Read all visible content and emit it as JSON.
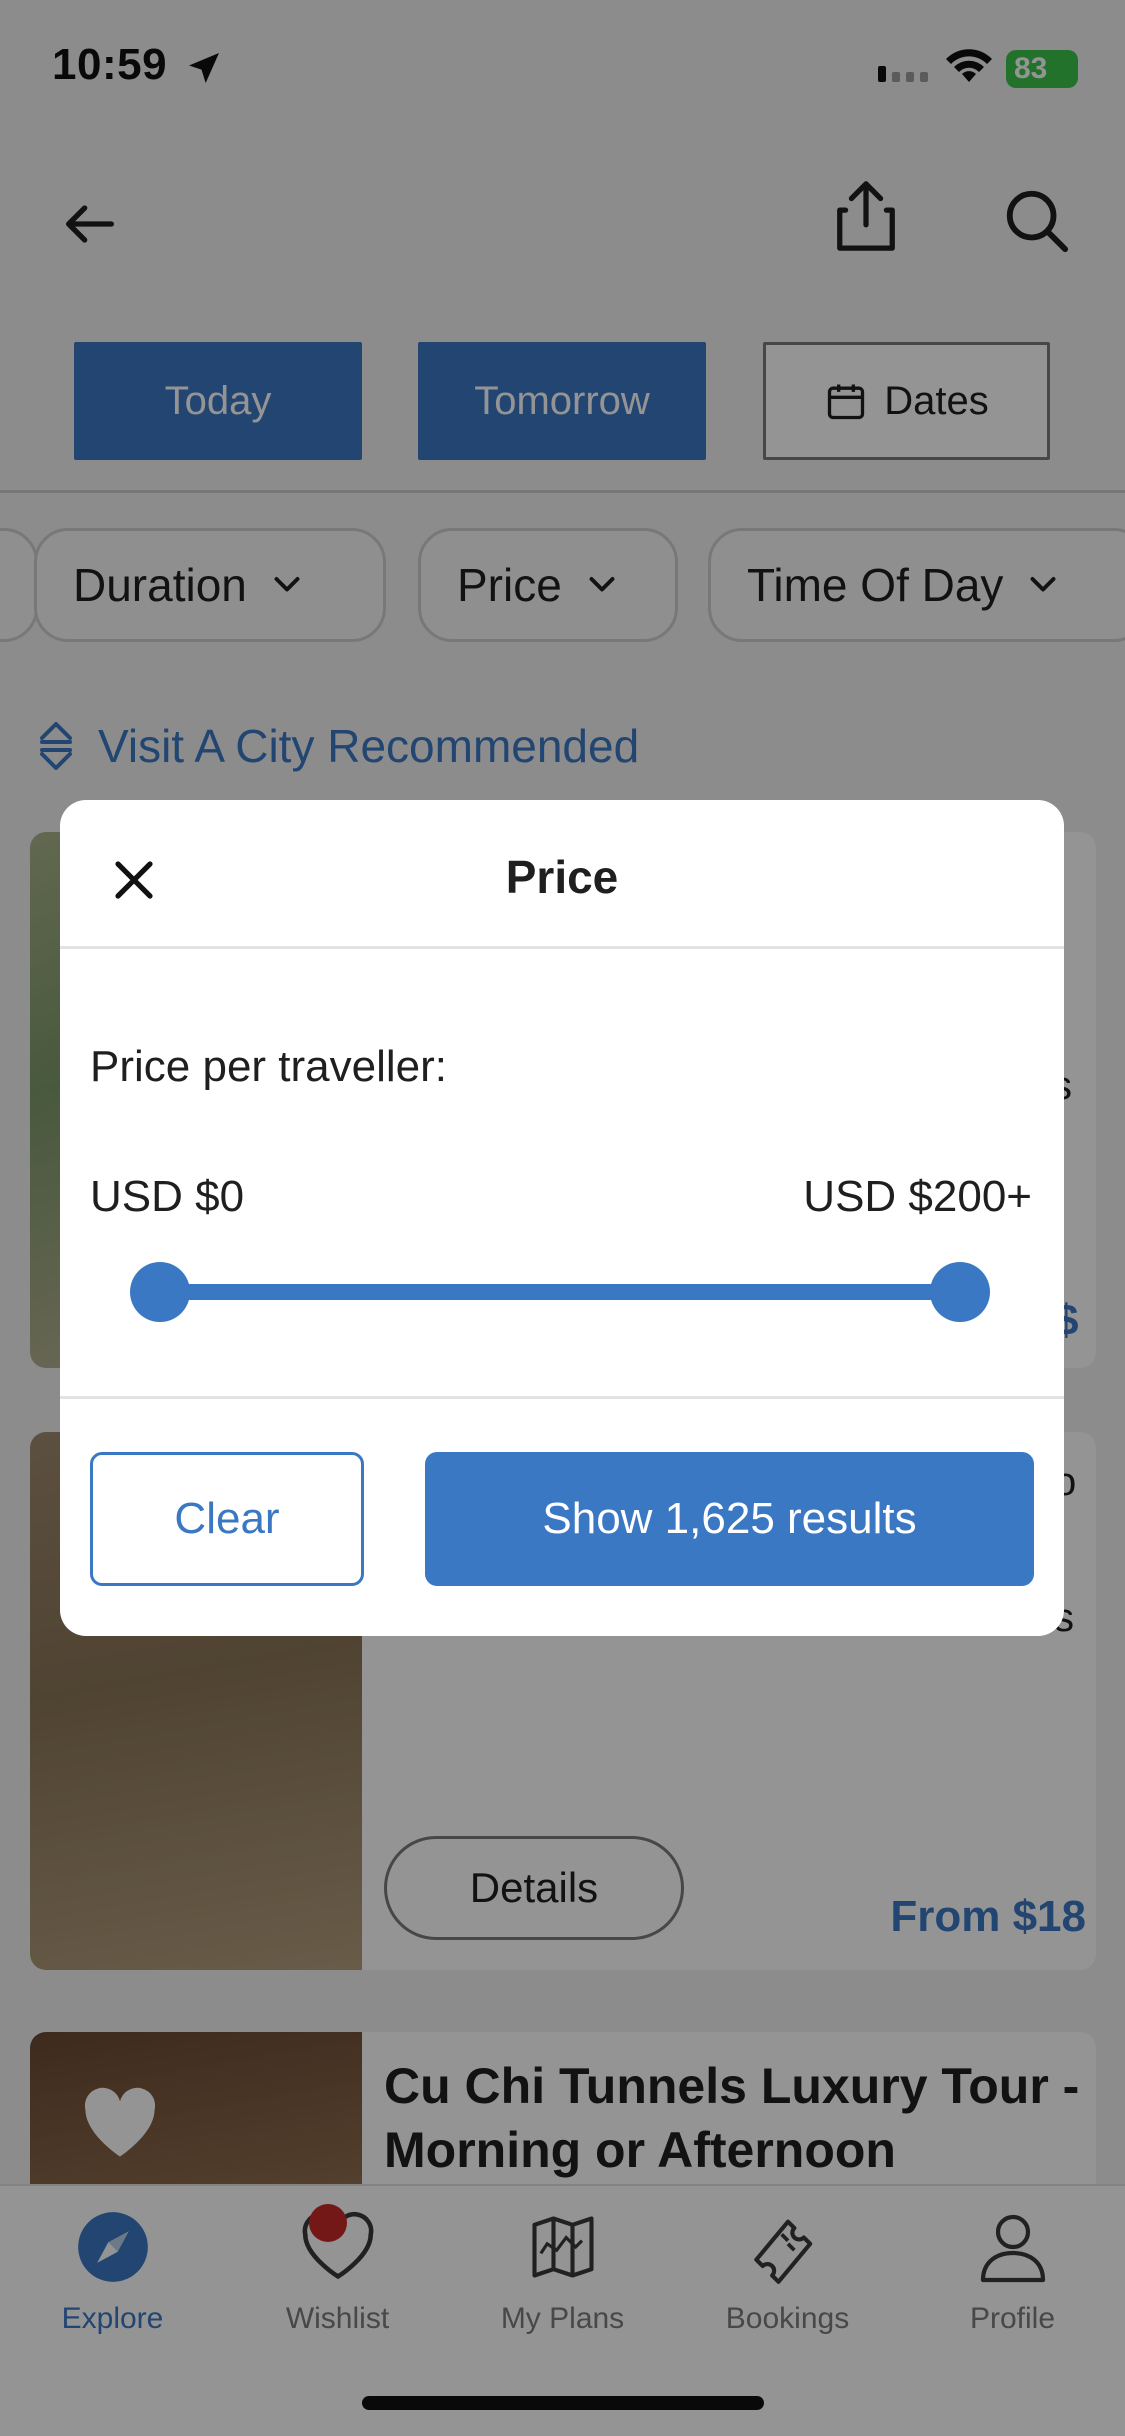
{
  "status_bar": {
    "time": "10:59",
    "battery": "83"
  },
  "header": {
    "back_icon": "arrow-left-icon",
    "share_icon": "share-icon",
    "search_icon": "search-icon"
  },
  "date_filters": {
    "today": "Today",
    "tomorrow": "Tomorrow",
    "dates": "Dates"
  },
  "filter_chips": [
    {
      "label": "Duration"
    },
    {
      "label": "Price"
    },
    {
      "label": "Time Of Day"
    }
  ],
  "sort": {
    "label": "Visit A City Recommended"
  },
  "cards": [
    {
      "price_peek": "$"
    },
    {
      "details_label": "Details",
      "price": "From $18"
    },
    {
      "title": "Cu Chi Tunnels Luxury Tour - Morning or Afternoon"
    }
  ],
  "modal": {
    "title": "Price",
    "label": "Price per traveller:",
    "min_label": "USD $0",
    "max_label": "USD $200+",
    "slider_min_fraction": 0,
    "slider_max_fraction": 1,
    "clear_label": "Clear",
    "show_label": "Show 1,625 results"
  },
  "tabbar": [
    {
      "label": "Explore",
      "icon": "compass-icon",
      "active": true
    },
    {
      "label": "Wishlist",
      "icon": "heart-icon",
      "badge": true
    },
    {
      "label": "My Plans",
      "icon": "map-icon"
    },
    {
      "label": "Bookings",
      "icon": "ticket-icon"
    },
    {
      "label": "Profile",
      "icon": "person-icon"
    }
  ],
  "colors": {
    "accent": "#3b78c4",
    "badge": "#c62828",
    "overlay": "rgba(0,0,0,0.42)"
  }
}
